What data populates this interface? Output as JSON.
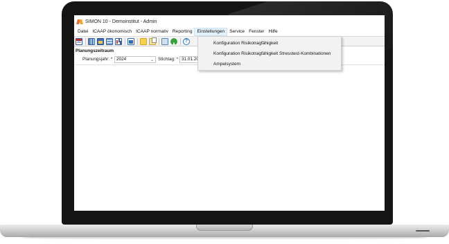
{
  "window": {
    "title": "SIMON 10 - Demoinstitut - Admin"
  },
  "menu": {
    "items": [
      "Datei",
      "ICAAP ökonomisch",
      "ICAAP normativ",
      "Reporting",
      "Einstellungen",
      "Service",
      "Fenster",
      "Hilfe"
    ],
    "open_item": "Einstellungen",
    "dropdown": [
      "Konfiguration Risikotragfähigkeit",
      "Konfiguration Risikotragfähigkeit Stresstest-Kombinationen",
      "Ampelsystem"
    ]
  },
  "toolbar": {
    "icons": [
      "calendar-icon",
      "grid-icon",
      "window-icon",
      "table-icon",
      "chart-icon",
      "report-icon",
      "note-icon",
      "copy-icon",
      "monitor-icon",
      "refresh-icon",
      "help-icon"
    ],
    "help_glyph": "?",
    "calendar_glyph": "31"
  },
  "planning": {
    "section_title": "Planungszeitraum",
    "year_label": "Planungsjahr: *",
    "year_value": "2024",
    "date_label": "Stichtag: *",
    "date_value": "31.01.20"
  },
  "colors": {
    "bezel": "#141414",
    "menu_highlight": "#e5f1fb",
    "dropdown_bg": "#f2f2f2",
    "app_accent": "#e8722a"
  }
}
